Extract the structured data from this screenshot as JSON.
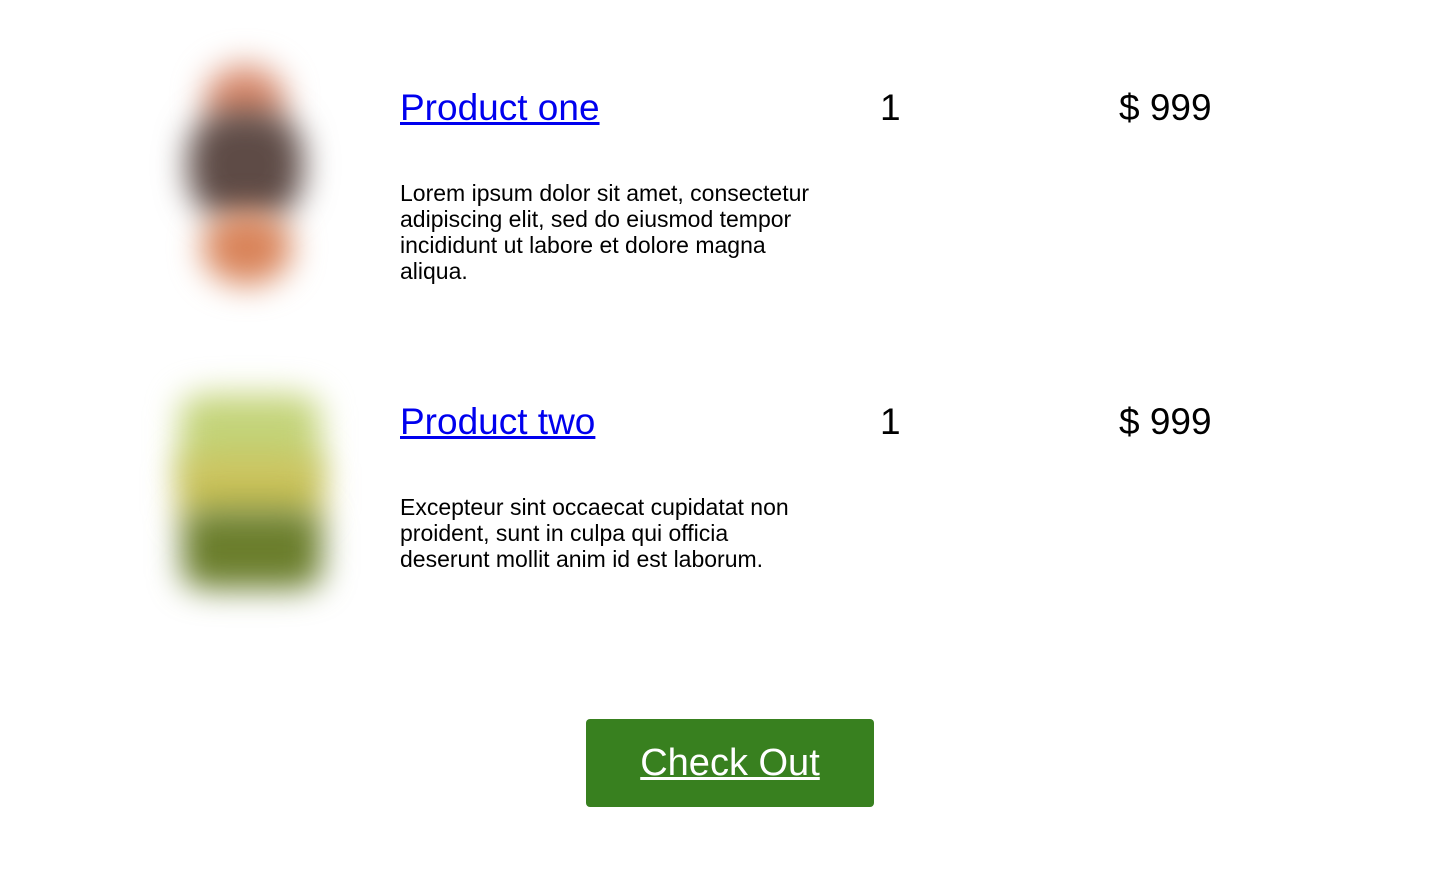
{
  "cart": {
    "items": [
      {
        "name": "Product one",
        "description": "Lorem ipsum dolor sit amet, consectetur adipiscing elit, sed do eiusmod tempor incididunt ut labore et dolore magna aliqua.",
        "quantity": "1",
        "price": "$ 999"
      },
      {
        "name": "Product two",
        "description": "Excepteur sint occaecat cupidatat non proident, sunt in culpa qui officia deserunt mollit anim id est laborum.",
        "quantity": "1",
        "price": "$ 999"
      }
    ]
  },
  "checkout": {
    "label": "Check Out",
    "color": "#38801f"
  },
  "colors": {
    "link": "#0000ee",
    "text": "#000000"
  }
}
